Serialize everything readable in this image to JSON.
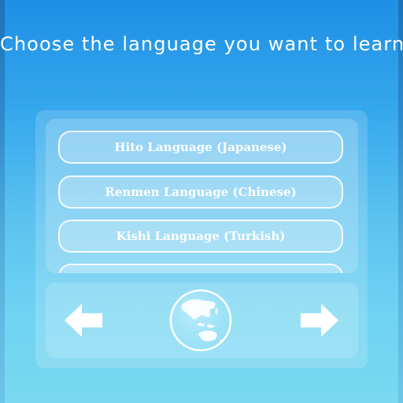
{
  "header": {
    "title": "Choose the language you want to learn"
  },
  "language_list": {
    "items": [
      {
        "label": "Hito Language (Japanese)"
      },
      {
        "label": "Renmen Language (Chinese)"
      },
      {
        "label": "Kishi Language (Turkish)"
      },
      {
        "label": ""
      }
    ]
  },
  "navigation": {
    "prev_icon": "arrow-left-icon",
    "next_icon": "arrow-right-icon",
    "globe_icon": "globe-icon"
  },
  "colors": {
    "background_top": "#1f8fe6",
    "background_bottom": "#7ad8f0",
    "text": "#ffffff"
  }
}
